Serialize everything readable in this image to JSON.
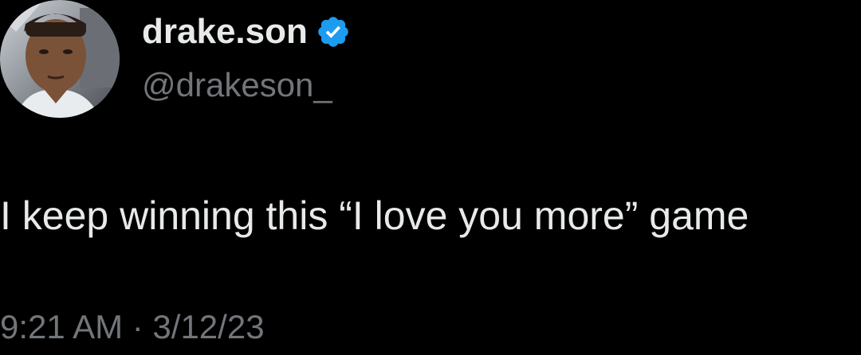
{
  "author": {
    "display_name": "drake.son",
    "handle": "@drakeson_",
    "verified": true,
    "verified_icon": "verified-badge-icon",
    "verified_color": "#1d9bf0"
  },
  "tweet": {
    "text": "I keep winning this “I love you more” game"
  },
  "meta": {
    "timestamp": "9:21 AM · 3/12/23"
  },
  "colors": {
    "background": "#000000",
    "primary_text": "#e7e9ea",
    "secondary_text": "#71767b"
  }
}
